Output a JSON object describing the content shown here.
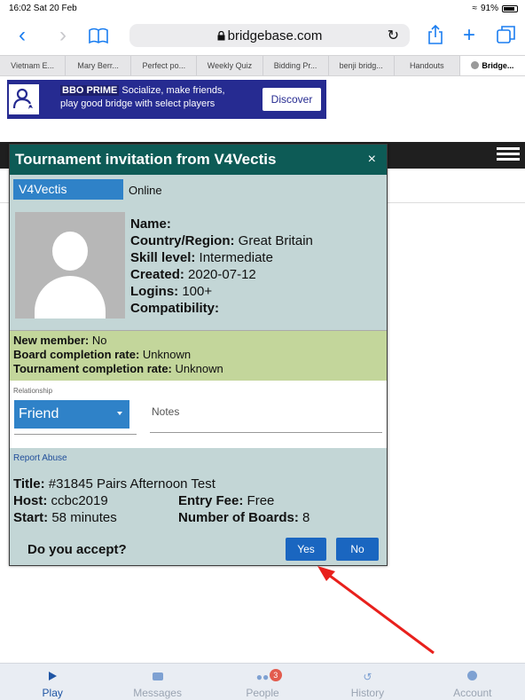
{
  "status": {
    "time": "16:02  Sat 20 Feb",
    "wifi": "≈",
    "battery": "91%"
  },
  "browser": {
    "host": "bridgebase.com",
    "tabs": [
      "Vietnam E...",
      "Mary Berr...",
      "Perfect po...",
      "Weekly Quiz",
      "Bidding Pr...",
      "benji bridg...",
      "Handouts",
      "Bridge..."
    ]
  },
  "banner": {
    "brand": "BBO PRIME",
    "line1": "Socialize, make friends,",
    "line2": "play good bridge with select players",
    "cta": "Discover"
  },
  "dialog": {
    "title": "Tournament invitation from V4Vectis",
    "close": "×",
    "username": "V4Vectis",
    "presence": "Online",
    "profile": {
      "name_label": "Name:",
      "name_value": "",
      "country_label": "Country/Region:",
      "country_value": "Great Britain",
      "skill_label": "Skill level:",
      "skill_value": "Intermediate",
      "created_label": "Created:",
      "created_value": "2020-07-12",
      "logins_label": "Logins:",
      "logins_value": "100+",
      "compat_label": "Compatibility:",
      "compat_value": ""
    },
    "member": {
      "new_label": "New member:",
      "new_value": "No",
      "board_label": "Board completion rate:",
      "board_value": "Unknown",
      "tour_label": "Tournament completion rate:",
      "tour_value": "Unknown"
    },
    "relationship_label": "Relationship",
    "relationship_value": "Friend",
    "notes_placeholder": "Notes",
    "report": "Report Abuse",
    "tournament": {
      "title_label": "Title:",
      "title_value": "#31845 Pairs Afternoon Test",
      "host_label": "Host:",
      "host_value": "ccbc2019",
      "fee_label": "Entry Fee:",
      "fee_value": "Free",
      "start_label": "Start:",
      "start_value": "58 minutes",
      "boards_label": "Number of Boards:",
      "boards_value": "8"
    },
    "question": "Do you accept?",
    "yes": "Yes",
    "no": "No"
  },
  "behind": {
    "fragment": ")"
  },
  "bottom_nav": {
    "play": "Play",
    "messages": "Messages",
    "people": "People",
    "people_badge": "3",
    "history": "History",
    "account": "Account"
  },
  "colors": {
    "dialog_header": "#0d5b56",
    "dialog_bg": "#c3d6d6",
    "member_bg": "#c3d69b",
    "accent_blue": "#2f82c8",
    "button_blue": "#1a66c0",
    "banner_bg": "#262b91",
    "arrow": "#e8201c"
  }
}
